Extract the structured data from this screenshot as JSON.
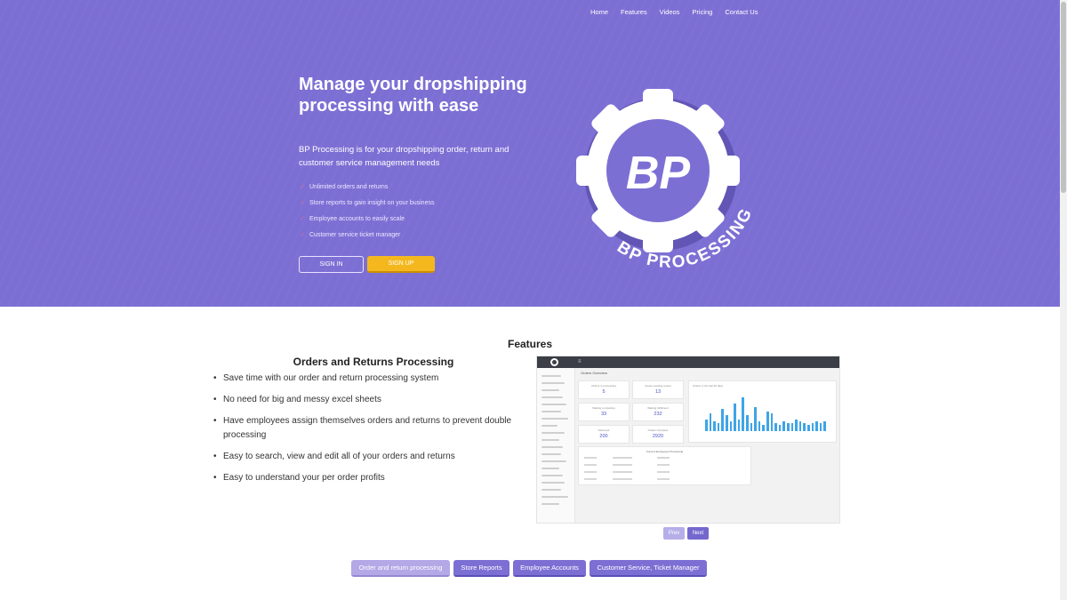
{
  "nav": {
    "items": [
      "Home",
      "Features",
      "Videos",
      "Pricing",
      "Contact Us"
    ]
  },
  "hero": {
    "title": "Manage your dropshipping processing with ease",
    "subtitle": "BP Processing is for your dropshipping order, return and customer service management needs",
    "checklist": [
      "Unlimited orders and returns",
      "Store reports to gain insight on your business",
      "Employee accounts to easily scale",
      "Customer service ticket manager"
    ],
    "signin_label": "SIGN IN",
    "signup_label": "SIGN UP",
    "logo": {
      "monogram": "BP",
      "wordmark": "BP PROCESSING",
      "icon": "gear-logo-icon"
    }
  },
  "features": {
    "heading": "Features",
    "section_title": "Orders and Returns Processing",
    "items": [
      "Save time with our order and return processing system",
      "No need for big and messy excel sheets",
      "Have employees assign themselves orders and returns to prevent double processing",
      "Easy to search, view and edit all of your orders and returns",
      "Easy to understand your per order profits"
    ],
    "screenshot": {
      "header": "Orders Overview",
      "cards": [
        {
          "label": "Orders in processing",
          "value": "5"
        },
        {
          "label": "Issues needing review",
          "value": "13"
        },
        {
          "label": "Waiting on tracking",
          "value": "33"
        },
        {
          "label": "Waiting fulfillment",
          "value": "232"
        },
        {
          "label": "Delivered",
          "value": "200"
        },
        {
          "label": "Orders Complete",
          "value": "2920"
        }
      ],
      "chart_title": "Orders in the last 30 days",
      "bar_values": [
        6,
        9,
        5,
        4,
        11,
        8,
        5,
        14,
        6,
        17,
        8,
        4,
        12,
        5,
        3,
        10,
        9,
        4,
        3,
        5,
        4,
        4,
        6,
        5,
        4,
        3,
        4,
        5,
        4,
        5
      ],
      "table_title": "Current Employees Processing"
    },
    "prev_label": "Prev",
    "next_label": "Next",
    "tabs": [
      "Order and return processing",
      "Store Reports",
      "Employee Accounts",
      "Customer Service, Ticket Manager"
    ],
    "active_tab": 0
  },
  "colors": {
    "hero_bg": "#7c6fd4",
    "accent_yellow": "#f4b81e",
    "chart_bar": "#3ea5e6"
  }
}
